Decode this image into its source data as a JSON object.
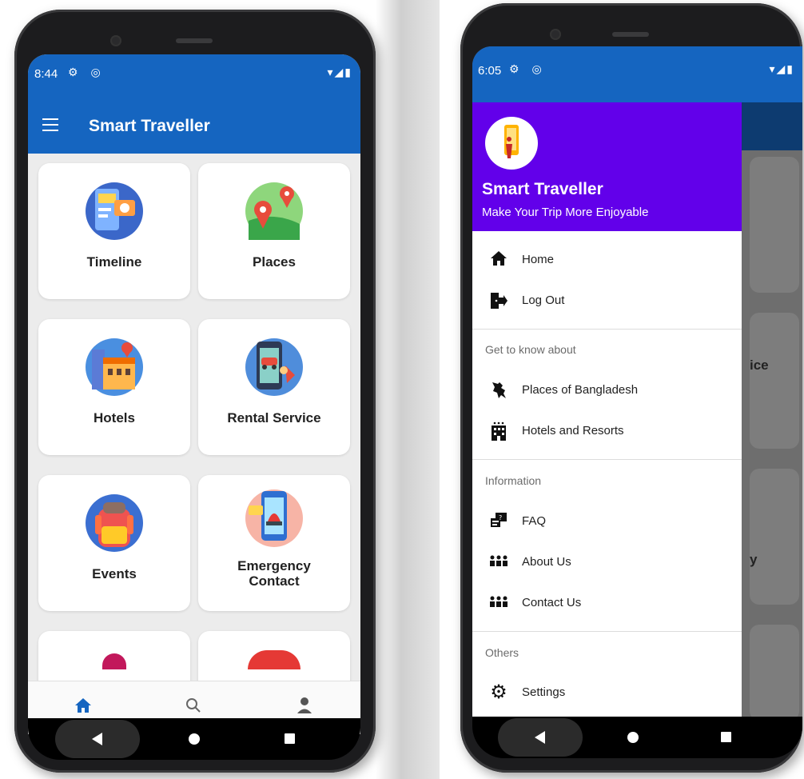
{
  "colors": {
    "primary": "#1565c0",
    "drawer_header": "#6200ea",
    "background": "#eeeeee"
  },
  "left_phone": {
    "status_time": "8:44",
    "status_icons": [
      "gear-icon",
      "at-icon"
    ],
    "app_title": "Smart Traveller",
    "cards": [
      {
        "label": "Timeline",
        "icon": "timeline-icon"
      },
      {
        "label": "Places",
        "icon": "map-pin-icon"
      },
      {
        "label": "Hotels",
        "icon": "hotel-icon"
      },
      {
        "label": "Rental Service",
        "icon": "rental-car-icon"
      },
      {
        "label": "Events",
        "icon": "backpack-icon"
      },
      {
        "label": "Emergency Contact",
        "label_line1": "Emergency",
        "label_line2": "Contact",
        "icon": "siren-phone-icon"
      }
    ],
    "bottom_nav": [
      "home-icon",
      "search-icon",
      "person-icon"
    ]
  },
  "right_phone": {
    "status_time": "6:05",
    "background_partial_texts": [
      "ice",
      "y"
    ],
    "drawer": {
      "title": "Smart Traveller",
      "subtitle": "Make Your Trip More Enjoyable",
      "items_top": [
        {
          "label": "Home",
          "icon": "home-icon"
        },
        {
          "label": "Log Out",
          "icon": "logout-icon"
        }
      ],
      "section_know": "Get to know about",
      "items_know": [
        {
          "label": "Places of Bangladesh",
          "icon": "bangladesh-map-icon"
        },
        {
          "label": "Hotels and Resorts",
          "icon": "building-icon"
        }
      ],
      "section_info": "Information",
      "items_info": [
        {
          "label": "FAQ",
          "icon": "faq-icon"
        },
        {
          "label": "About Us",
          "icon": "group-icon"
        },
        {
          "label": "Contact Us",
          "icon": "group-icon"
        }
      ],
      "section_others": "Others",
      "items_others": [
        {
          "label": "Settings",
          "icon": "gear-icon"
        }
      ]
    }
  }
}
